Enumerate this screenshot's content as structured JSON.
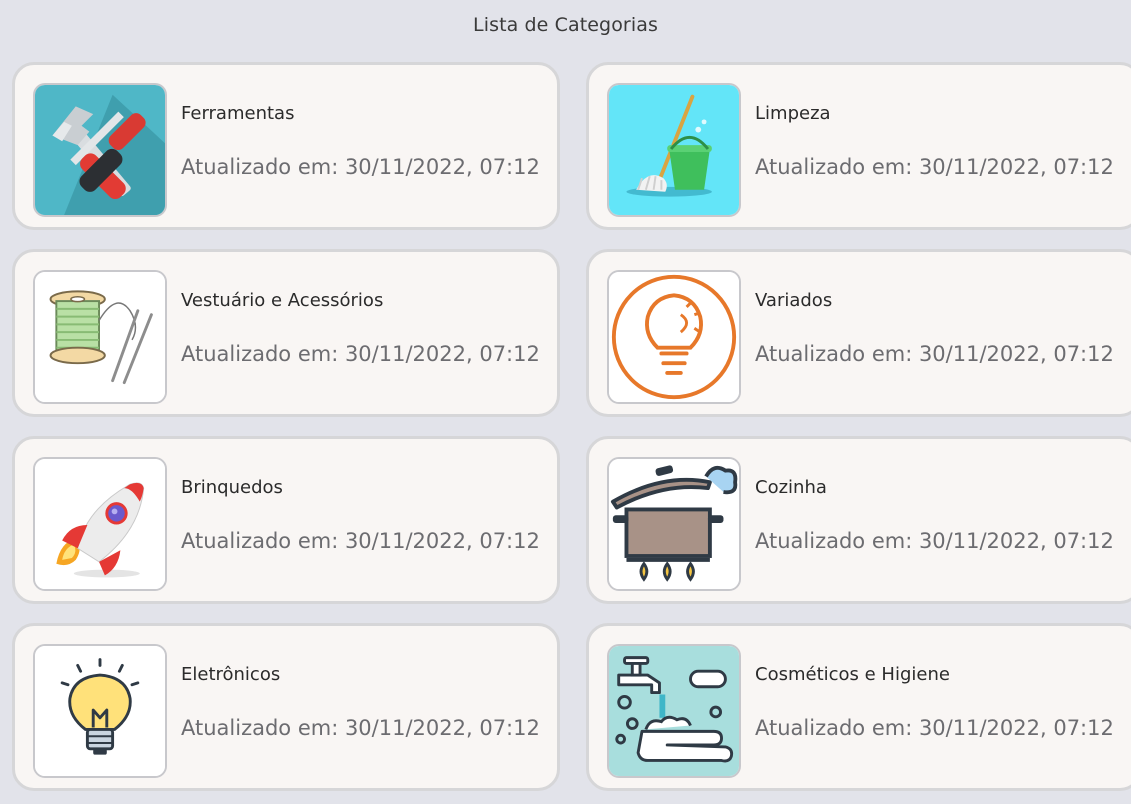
{
  "page": {
    "title": "Lista de Categorias"
  },
  "categories": [
    {
      "name": "Ferramentas",
      "updated": "Atualizado em: 30/11/2022, 07:12",
      "icon": "hammer-screwdriver-icon"
    },
    {
      "name": "Limpeza",
      "updated": "Atualizado em: 30/11/2022, 07:12",
      "icon": "mop-bucket-icon"
    },
    {
      "name": "Vestuário e Acessórios",
      "updated": "Atualizado em: 30/11/2022, 07:12",
      "icon": "thread-needles-icon"
    },
    {
      "name": "Variados",
      "updated": "Atualizado em: 30/11/2022, 07:12",
      "icon": "lightbulb-gear-icon"
    },
    {
      "name": "Brinquedos",
      "updated": "Atualizado em: 30/11/2022, 07:12",
      "icon": "rocket-icon"
    },
    {
      "name": "Cozinha",
      "updated": "Atualizado em: 30/11/2022, 07:12",
      "icon": "cooking-pot-icon"
    },
    {
      "name": "Eletrônicos",
      "updated": "Atualizado em: 30/11/2022, 07:12",
      "icon": "lightbulb-icon"
    },
    {
      "name": "Cosméticos e Higiene",
      "updated": "Atualizado em: 30/11/2022, 07:12",
      "icon": "hand-washing-icon"
    }
  ],
  "colors": {
    "background": "#e2e3ea",
    "card_background": "#f9f6f4",
    "card_border": "#d6d6d8",
    "muted_text": "#6c6c70"
  }
}
